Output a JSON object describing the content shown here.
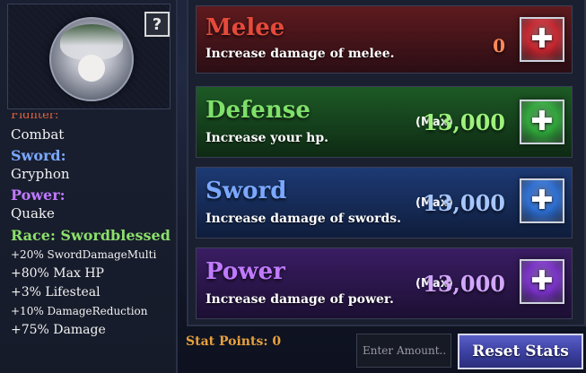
{
  "help_button": {
    "label": "?"
  },
  "character": {
    "cut_off_label": "Fighter:",
    "style_value": "Combat",
    "sword_label": "Sword:",
    "sword_value": "Gryphon",
    "power_label": "Power:",
    "power_value": "Quake",
    "race_line": "Race: Swordblessed",
    "bonuses": [
      "+20% SwordDamageMulti",
      "+80% Max HP",
      "+3% Lifesteal",
      "+10% DamageReduction",
      "+75% Damage"
    ]
  },
  "stats": [
    {
      "name": "Melee",
      "description": "Increase damage of melee.",
      "max_tag": "",
      "value": "0",
      "colors": {
        "name": "#e54a3a",
        "value": "#ff8a5a",
        "bg_top": "#5e1a1e",
        "bg_bottom": "#2b0e14",
        "btn": "#c8262f"
      }
    },
    {
      "name": "Defense",
      "description": "Increase your hp.",
      "max_tag": "(Max)",
      "value": "13,000",
      "colors": {
        "name": "#7fe06a",
        "value": "#9ef27c",
        "bg_top": "#1d5a25",
        "bg_bottom": "#0e2a14",
        "btn": "#2fa63a"
      }
    },
    {
      "name": "Sword",
      "description": "Increase damage of swords.",
      "max_tag": "(Max)",
      "value": "13,000",
      "colors": {
        "name": "#7ba8ff",
        "value": "#a7c6ff",
        "bg_top": "#1d3a74",
        "bg_bottom": "#0f1d3c",
        "btn": "#2d6fd3"
      }
    },
    {
      "name": "Power",
      "description": "Increase damage of power.",
      "max_tag": "(Max)",
      "value": "13,000",
      "colors": {
        "name": "#c07aff",
        "value": "#d3a6ff",
        "bg_top": "#3a1d63",
        "bg_bottom": "#1c0f33",
        "btn": "#7a32c8"
      }
    }
  ],
  "stat_points": {
    "label": "Stat Points: 0"
  },
  "amount_input": {
    "placeholder": "Enter Amount.."
  },
  "reset_button": {
    "label": "Reset Stats"
  },
  "label_colors": {
    "sword": "#7ba8ff",
    "power": "#c07aff",
    "race": "#8be06a",
    "stat_points": "#e8a13c"
  }
}
